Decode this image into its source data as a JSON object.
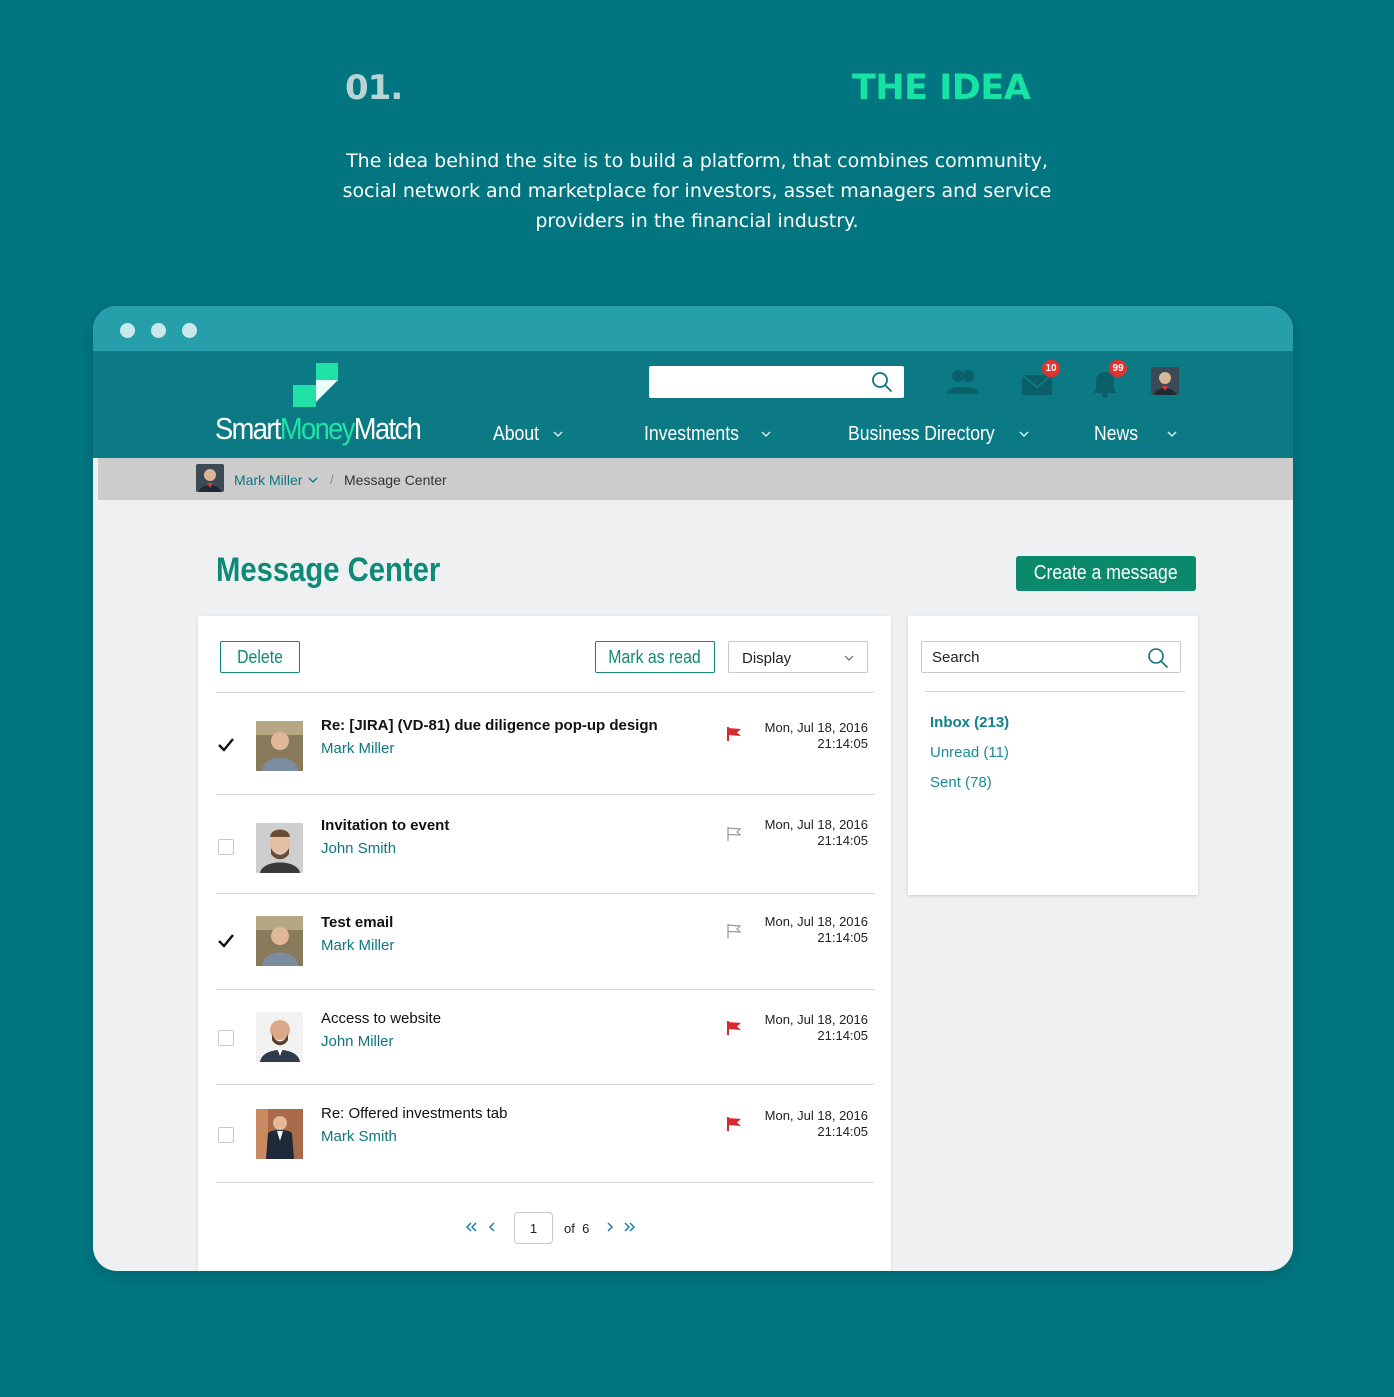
{
  "hero": {
    "number": "01.",
    "title": "THE IDEA",
    "description": "The idea behind the site is to build a platform, that combines community, social network and marketplace for investors, asset managers and service providers in the financial industry."
  },
  "header": {
    "logo": {
      "part1": "Smart",
      "part2": "Money",
      "part3": "Match"
    },
    "icons": {
      "community": "people-icon",
      "messages": "envelope-icon",
      "notifications": "bell-icon"
    },
    "messages_badge": "10",
    "notifications_badge": "99",
    "nav": [
      {
        "label": "About"
      },
      {
        "label": "Investments"
      },
      {
        "label": "Business Directory"
      },
      {
        "label": "News"
      }
    ]
  },
  "breadcrumb": {
    "user": "Mark Miller",
    "separator": "/",
    "current": "Message Center"
  },
  "page": {
    "title": "Message Center",
    "create_button": "Create a message"
  },
  "toolbar": {
    "delete_label": "Delete",
    "mark_read_label": "Mark as read",
    "display_label": "Display"
  },
  "messages": [
    {
      "subject": "Re: [JIRA] (VD-81) due diligence pop-up design",
      "sender": "Mark Miller",
      "date": "Mon, Jul 18, 2016",
      "time": "21:14:05",
      "checked": true,
      "flagged": true,
      "unread": true
    },
    {
      "subject": "Invitation to event",
      "sender": "John Smith",
      "date": "Mon, Jul 18, 2016",
      "time": "21:14:05",
      "checked": false,
      "flagged": false,
      "unread": true
    },
    {
      "subject": "Test email",
      "sender": "Mark Miller",
      "date": "Mon, Jul 18, 2016",
      "time": "21:14:05",
      "checked": true,
      "flagged": false,
      "unread": true
    },
    {
      "subject": "Access to website",
      "sender": "John Miller",
      "date": "Mon, Jul 18, 2016",
      "time": "21:14:05",
      "checked": false,
      "flagged": true,
      "unread": false
    },
    {
      "subject": "Re: Offered investments tab",
      "sender": "Mark Smith",
      "date": "Mon, Jul 18, 2016",
      "time": "21:14:05",
      "checked": false,
      "flagged": true,
      "unread": false
    }
  ],
  "pagination": {
    "current_page": "1",
    "of_label": "of",
    "total_pages": "6"
  },
  "sidebar": {
    "search_placeholder": "Search",
    "folders": [
      {
        "label": "Inbox (213)"
      },
      {
        "label": "Unread (11)"
      },
      {
        "label": "Sent (78)"
      }
    ]
  },
  "colors": {
    "background": "#017580",
    "accent_green": "#17e3a5",
    "header": "#0b7a85",
    "titlebar": "#279fab",
    "primary_button": "#0b8a6b",
    "flag_red": "#d8292e",
    "badge_red": "#e3312f"
  }
}
